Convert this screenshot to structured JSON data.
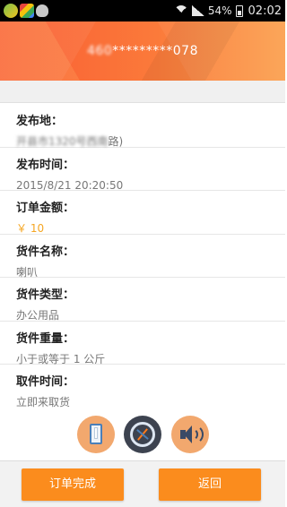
{
  "status_bar": {
    "battery_percent": "54%",
    "time": "02:02",
    "icons": [
      "app-icon-green",
      "app-icon-google",
      "android-icon",
      "wifi-icon",
      "signal-icon",
      "battery-icon"
    ]
  },
  "header": {
    "phone_prefix": "460",
    "phone_masked": "*********078"
  },
  "details": {
    "origin_label": "发布地：",
    "origin_value_hidden": "开县市1320号西南",
    "origin_value_tail": "路)",
    "publish_time_label": "发布时间：",
    "publish_time_value": "2015/8/21 20:20:50",
    "amount_label": "订单金额：",
    "amount_value": "￥ 10",
    "goods_name_label": "货件名称：",
    "goods_name_value": "喇叭",
    "goods_type_label": "货件类型：",
    "goods_type_value": "办公用品",
    "goods_weight_label": "货件重量：",
    "goods_weight_value": "小于或等于 1 公斤",
    "pickup_time_label": "取件时间：",
    "pickup_time_value": "立即来取货"
  },
  "actions": {
    "icons": [
      "phone-icon",
      "compass-icon",
      "speaker-icon"
    ]
  },
  "buttons": {
    "complete_label": "订单完成",
    "back_label": "返回"
  },
  "colors": {
    "header_orange": "#f95d34",
    "button_orange": "#fb8c1d",
    "price_color": "#f5a623"
  }
}
